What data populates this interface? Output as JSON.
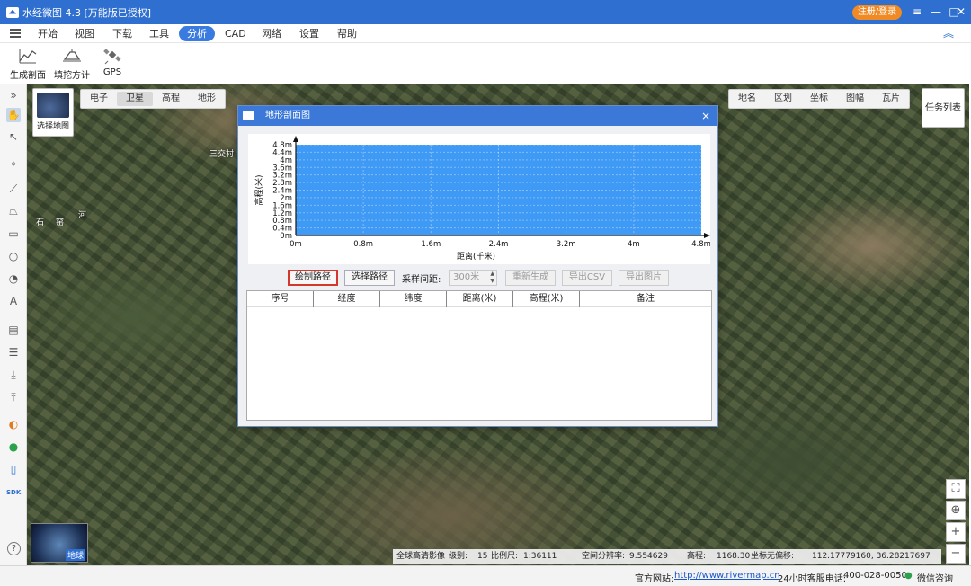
{
  "app": {
    "title": "水经微图 4.3 [万能版已授权]",
    "login_label": "注册/登录"
  },
  "window_controls": {
    "menu": "≡",
    "minimize": "—",
    "maximize": "□",
    "close": "✕"
  },
  "menu": {
    "items": [
      "开始",
      "视图",
      "下载",
      "工具",
      "分析",
      "CAD",
      "网络",
      "设置",
      "帮助"
    ],
    "active": "分析"
  },
  "ribbon": {
    "buttons": [
      {
        "label": "生成剖面图",
        "icon": "profile-chart-icon"
      },
      {
        "label": "填挖方计算",
        "icon": "cut-fill-icon"
      },
      {
        "label": "GPS",
        "icon": "satellite-icon"
      }
    ]
  },
  "map_controls": {
    "map_type_label": "选择地图",
    "base_tabs": [
      "电子",
      "卫星",
      "高程",
      "地形"
    ],
    "base_tab_active": "卫星",
    "overlay_tabs": [
      "地名",
      "区划",
      "坐标",
      "图幅",
      "瓦片"
    ],
    "task_list": "任务列表",
    "globe_label": "地球",
    "map_labels": [
      "三交村",
      "石",
      "窑",
      "河"
    ]
  },
  "dialog": {
    "title": "地形剖面图",
    "close": "×",
    "buttons": {
      "draw_path": "绘制路径",
      "select_path": "选择路径",
      "sample_interval_label": "采样间距:",
      "sample_interval_value": "300米",
      "regenerate": "重新生成",
      "export_csv": "导出CSV",
      "export_image": "导出图片"
    },
    "table_headers": [
      "序号",
      "经度",
      "纬度",
      "距离(米)",
      "高程(米)",
      "备注"
    ]
  },
  "chart_data": {
    "type": "area",
    "title": "",
    "xlabel": "距离(千米)",
    "ylabel": "高程(米)",
    "x_ticks": [
      "0m",
      "0.8m",
      "1.6m",
      "2.4m",
      "3.2m",
      "4m",
      "4.8m"
    ],
    "y_ticks": [
      "0m",
      "0.4m",
      "0.8m",
      "1.2m",
      "1.6m",
      "2m",
      "2.4m",
      "2.8m",
      "3.2m",
      "3.6m",
      "4m",
      "4.4m",
      "4.8m"
    ],
    "xlim": [
      0,
      4.8
    ],
    "ylim": [
      0,
      4.8
    ],
    "x": [
      0,
      4.8
    ],
    "y": [
      4.8,
      4.8
    ],
    "fill_color": "#3f9af5",
    "grid": true
  },
  "map_status": {
    "source": "全球高清影像",
    "level_label": "级别:",
    "level": "15",
    "scale_label": "比例尺:",
    "scale": "1:36111",
    "resolution_label": "空间分辨率:",
    "resolution": "9.554629",
    "elevation_label": "高程:",
    "elevation": "1168.30",
    "coord_label": "坐标无偏移:",
    "coords": "112.17779160, 36.28217697"
  },
  "statusbar": {
    "website_label": "官方网站:",
    "website": "http://www.rivermap.cn",
    "hotline_label": "24小时客服电话:",
    "hotline": "400-028-0050",
    "wechat": "微信咨询"
  },
  "colors": {
    "accent": "#2f6fd0",
    "login": "#f08a24",
    "highlight_border": "#d4382c",
    "chart_fill": "#3f9af5"
  }
}
